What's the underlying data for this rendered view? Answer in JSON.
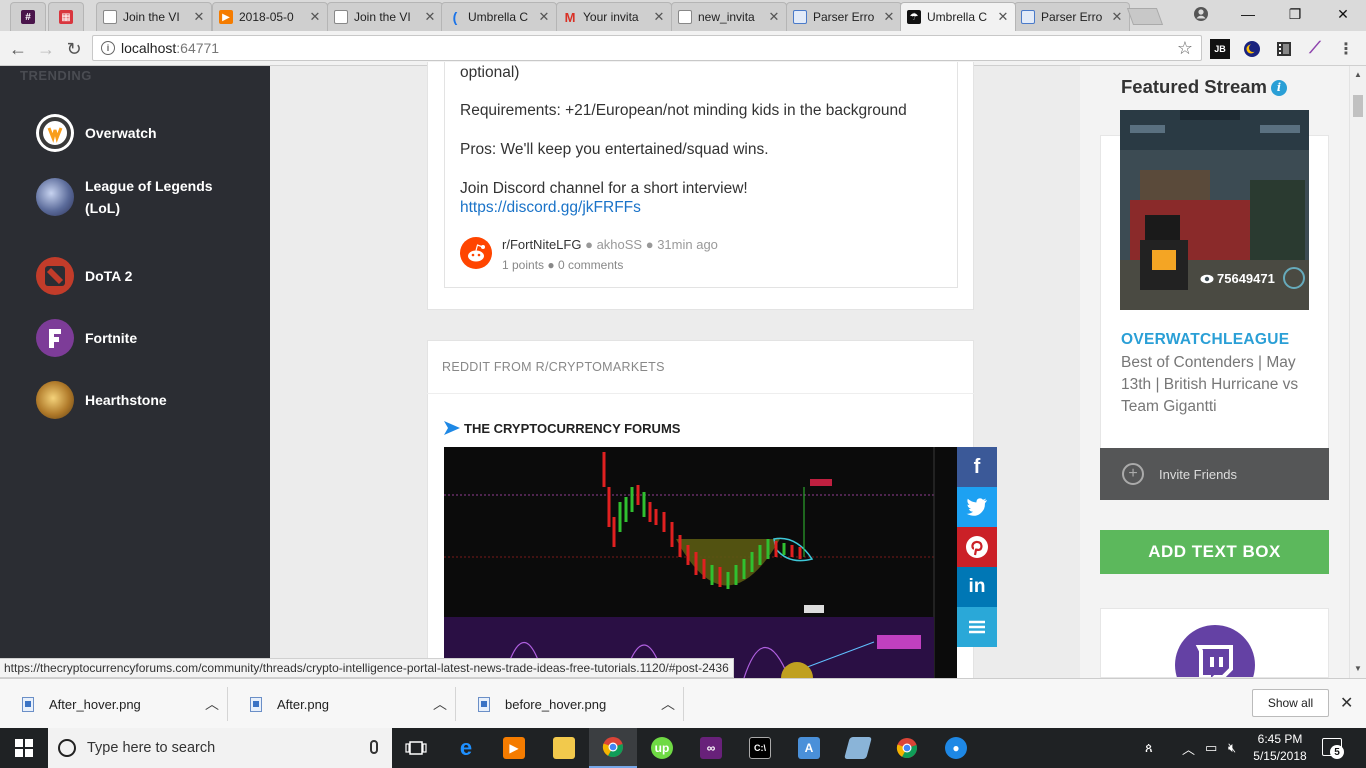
{
  "browser": {
    "tabs": [
      {
        "label": "",
        "icon": "slack-icon",
        "color": "#4a154b"
      },
      {
        "label": "",
        "icon": "calendar-icon",
        "color": "#d9363e"
      },
      {
        "label": "Join the VI",
        "icon": "document-icon",
        "color": "#888888"
      },
      {
        "label": "2018-05-0",
        "icon": "play-icon",
        "color": "#f57c00"
      },
      {
        "label": "Join the VI",
        "icon": "document-icon",
        "color": "#888888"
      },
      {
        "label": "Umbrella C",
        "icon": "loading-icon",
        "color": "#1a73e8"
      },
      {
        "label": "Your invita",
        "icon": "gmail-icon",
        "color": "#d93025"
      },
      {
        "label": "new_invita",
        "icon": "document-icon",
        "color": "#888888"
      },
      {
        "label": "Parser Erro",
        "icon": "page-icon",
        "color": "#4a7ac9"
      },
      {
        "label": "Umbrella C",
        "icon": "umbrella-icon",
        "color": "#111111"
      },
      {
        "label": "Parser Erro",
        "icon": "page-icon",
        "color": "#4a7ac9"
      }
    ],
    "address": {
      "host": "localhost",
      "port": ":64771"
    }
  },
  "sidebar": {
    "heading": "TRENDING",
    "games": [
      {
        "name": "Overwatch",
        "icon": "overwatch-icon",
        "color": "#ffffff"
      },
      {
        "name": "League of Legends (LoL)",
        "icon": "league-of-legends-icon",
        "color": "#5b6b9a"
      },
      {
        "name": "DoTA 2",
        "icon": "dota2-icon",
        "color": "#c23c2a"
      },
      {
        "name": "Fortnite",
        "icon": "fortnite-icon",
        "color": "#7d3c98"
      },
      {
        "name": "Hearthstone",
        "icon": "hearthstone-icon",
        "color": "#b07a2a"
      }
    ]
  },
  "post": {
    "line_optional": "optional)",
    "requirements": "Requirements: +21/European/not minding kids in the background",
    "pros": "Pros: We'll keep you entertained/squad wins.",
    "join": "Join Discord channel for a short interview!",
    "link": "https://discord.gg/jkFRFFs",
    "subreddit": "r/FortNiteLFG",
    "author": "akhoSS",
    "time": "31min ago",
    "points": "1 points",
    "comments": "0 comments"
  },
  "crypto": {
    "section_title": "REDDIT FROM R/CRYPTOMARKETS",
    "forum_title": "THE CRYPTOCURRENCY FORUMS"
  },
  "share": [
    {
      "name": "facebook",
      "glyph": "f",
      "color": "#3b5998"
    },
    {
      "name": "twitter",
      "glyph": "t",
      "color": "#1da1f2"
    },
    {
      "name": "pinterest",
      "glyph": "p",
      "color": "#cb2027"
    },
    {
      "name": "linkedin",
      "glyph": "in",
      "color": "#0077b5"
    },
    {
      "name": "buffer",
      "glyph": "≡",
      "color": "#2aa8d8"
    }
  ],
  "featured": {
    "title": "Featured Stream",
    "viewers": "75649471",
    "channel": "OVERWATCHLEAGUE",
    "description": "Best of Contenders | May 13th | British Hurricane vs Team Gigantti",
    "invite": "Invite Friends",
    "add_text_box": "ADD TEXT BOX"
  },
  "status_url": "https://thecryptocurrencyforums.com/community/threads/crypto-intelligence-portal-latest-news-trade-ideas-free-tutorials.1120/#post-2436",
  "downloads": {
    "items": [
      "After_hover.png",
      "After.png",
      "before_hover.png"
    ],
    "show_all": "Show all"
  },
  "taskbar": {
    "search_placeholder": "Type here to search",
    "time": "6:45 PM",
    "date": "5/15/2018",
    "notifications": "5"
  },
  "colors": {
    "sidebar_bg": "#2b2d33",
    "accent_blue": "#2a9fd6",
    "add_green": "#5cb85c"
  }
}
